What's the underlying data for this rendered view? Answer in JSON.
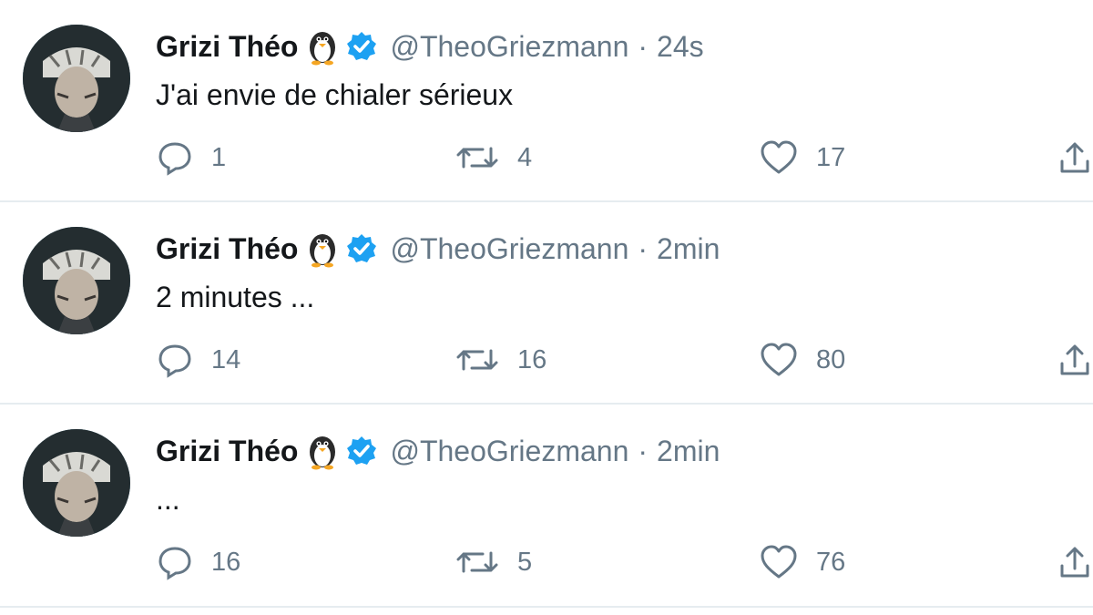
{
  "icons": {
    "penguin": "penguin-emoji-icon",
    "verified": "verified-badge-icon",
    "reply": "reply-icon",
    "retweet": "retweet-icon",
    "like": "heart-icon",
    "share": "share-icon"
  },
  "colors": {
    "verified": "#1da1f2",
    "secondary_text": "#657786",
    "divider": "#e6ecf0"
  },
  "tweets": [
    {
      "author_name": "Grizi Théo",
      "handle": "@TheoGriezmann",
      "separator": "·",
      "time": "24s",
      "text": "J'ai envie de chialer sérieux",
      "replies": "1",
      "retweets": "4",
      "likes": "17"
    },
    {
      "author_name": "Grizi Théo",
      "handle": "@TheoGriezmann",
      "separator": "·",
      "time": "2min",
      "text": "2 minutes ...",
      "replies": "14",
      "retweets": "16",
      "likes": "80"
    },
    {
      "author_name": "Grizi Théo",
      "handle": "@TheoGriezmann",
      "separator": "·",
      "time": "2min",
      "text": "...",
      "replies": "16",
      "retweets": "5",
      "likes": "76"
    }
  ]
}
